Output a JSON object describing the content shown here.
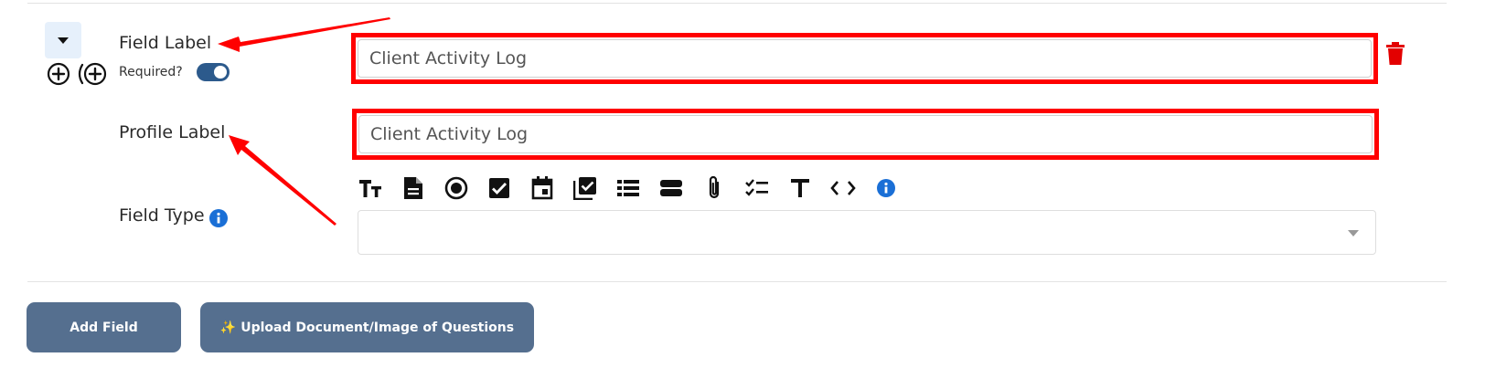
{
  "field": {
    "label": "Field Label",
    "required_label": "Required?",
    "required": true,
    "value": "Client Activity Log"
  },
  "profile": {
    "label": "Profile Label",
    "value": "Client Activity Log"
  },
  "field_type": {
    "label": "Field Type",
    "selected": "",
    "type_icons": [
      "text-size-icon",
      "document-icon",
      "radio-icon",
      "checkbox-icon",
      "calendar-icon",
      "multi-checkbox-icon",
      "list-icon",
      "dropdown-icon",
      "attachment-icon",
      "checklist-icon",
      "text-icon",
      "code-icon",
      "info-icon"
    ]
  },
  "actions": {
    "add_field": "Add Field",
    "upload": "✨ Upload Document/Image of Questions"
  },
  "colors": {
    "annotation": "#ff0000",
    "button_bg": "#556f8f",
    "toggle_on": "#2c5a8c",
    "info_blue": "#1a6fd6",
    "trash_red": "#e30000"
  }
}
